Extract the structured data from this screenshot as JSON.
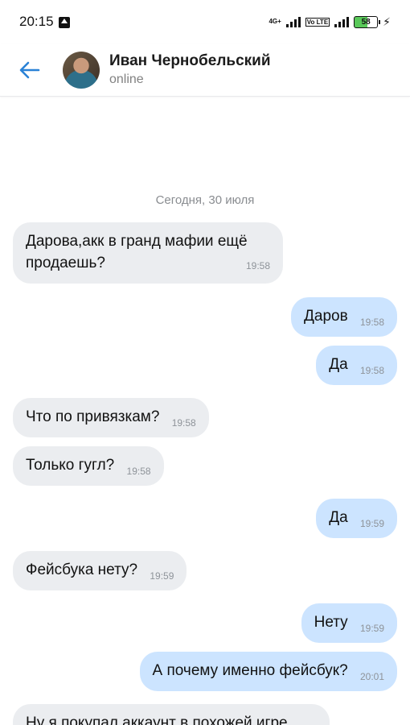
{
  "status_bar": {
    "time": "20:15",
    "net1": "4G+",
    "volte": "Vo LTE",
    "battery": "58"
  },
  "header": {
    "contact_name": "Иван Чернобельский",
    "status": "online"
  },
  "chat": {
    "date": "Сегодня, 30 июля",
    "messages": [
      {
        "text": "Дарова,акк в гранд мафии ещё продаешь?",
        "time": "19:58"
      },
      {
        "text": "Даров",
        "time": "19:58"
      },
      {
        "text": "Да",
        "time": "19:58"
      },
      {
        "text": "Что по привязкам?",
        "time": "19:58"
      },
      {
        "text": "Только гугл?",
        "time": "19:58"
      },
      {
        "text": "Да",
        "time": "19:59"
      },
      {
        "text": "Фейсбука нету?",
        "time": "19:59"
      },
      {
        "text": "Нету",
        "time": "19:59"
      },
      {
        "text": "А почему именно фейсбук?",
        "time": "20:01"
      },
      {
        "text": "Ну я покупал аккаунт в похожей игре",
        "time": ""
      }
    ]
  },
  "colors": {
    "incoming_bubble": "#ebedf0",
    "outgoing_bubble": "#cce4ff",
    "accent": "#2a82d6"
  }
}
